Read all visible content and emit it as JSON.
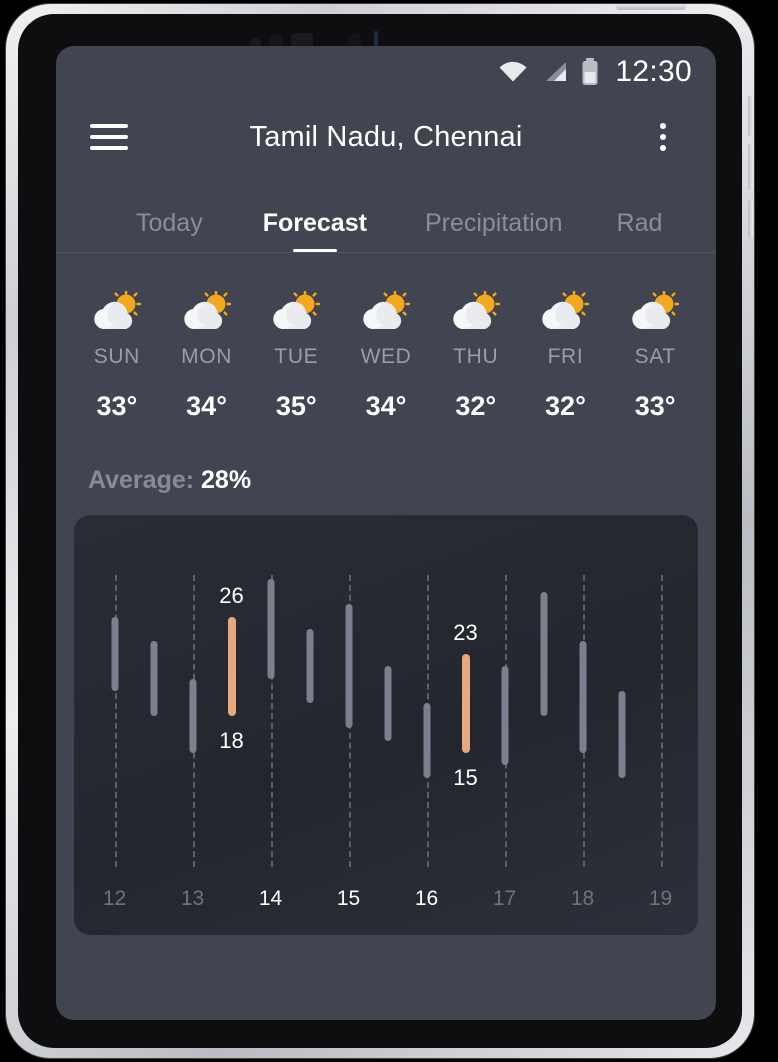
{
  "status_bar": {
    "time": "12:30",
    "icons": [
      "wifi-icon",
      "cellular-signal-icon",
      "battery-icon"
    ]
  },
  "app_bar": {
    "menu_icon": "hamburger-menu-icon",
    "title": "Tamil Nadu, Chennai",
    "overflow_icon": "more-vertical-icon"
  },
  "tabs": [
    {
      "label": "Today",
      "active": false
    },
    {
      "label": "Forecast",
      "active": true
    },
    {
      "label": "Precipitation",
      "active": false
    },
    {
      "label": "Rad",
      "active": false
    }
  ],
  "daily_forecast": [
    {
      "day": "SUN",
      "temp": "33°",
      "icon": "sun-behind-cloud-icon"
    },
    {
      "day": "MON",
      "temp": "34°",
      "icon": "sun-behind-cloud-icon"
    },
    {
      "day": "TUE",
      "temp": "35°",
      "icon": "sun-behind-cloud-icon"
    },
    {
      "day": "WED",
      "temp": "34°",
      "icon": "sun-behind-cloud-icon"
    },
    {
      "day": "THU",
      "temp": "32°",
      "icon": "sun-behind-cloud-icon"
    },
    {
      "day": "FRI",
      "temp": "32°",
      "icon": "sun-behind-cloud-icon"
    },
    {
      "day": "SAT",
      "temp": "33°",
      "icon": "sun-behind-cloud-icon"
    }
  ],
  "average": {
    "label": "Average:",
    "value": "28%"
  },
  "colors": {
    "screen_background": "#414451",
    "chart_background": "#272A33",
    "bar_default": "#7C808E",
    "bar_highlight": "#E7A87F",
    "text_primary": "#FFFFFF",
    "text_muted": "#8B8E99",
    "gridline": "#5C5F6B"
  },
  "chart_data": {
    "type": "bar",
    "title": "",
    "xlabel": "",
    "ylabel": "",
    "grid": "vertical-dashed",
    "legend": "none",
    "x_ticks": [
      {
        "label": "12",
        "highlighted": false
      },
      {
        "label": "13",
        "highlighted": false
      },
      {
        "label": "14",
        "highlighted": true
      },
      {
        "label": "15",
        "highlighted": true
      },
      {
        "label": "16",
        "highlighted": true
      },
      {
        "label": "17",
        "highlighted": false
      },
      {
        "label": "18",
        "highlighted": false
      },
      {
        "label": "19",
        "highlighted": false
      }
    ],
    "ylim": [
      10,
      30
    ],
    "bars": [
      {
        "index": 0,
        "low": 20,
        "high": 26,
        "highlighted": false,
        "label_top": "",
        "label_bottom": ""
      },
      {
        "index": 1,
        "low": 18,
        "high": 24,
        "highlighted": false,
        "label_top": "",
        "label_bottom": ""
      },
      {
        "index": 2,
        "low": 15,
        "high": 21,
        "highlighted": false,
        "label_top": "",
        "label_bottom": ""
      },
      {
        "index": 3,
        "low": 18,
        "high": 26,
        "highlighted": true,
        "label_top": "26",
        "label_bottom": "18"
      },
      {
        "index": 4,
        "low": 21,
        "high": 29,
        "highlighted": false,
        "label_top": "",
        "label_bottom": ""
      },
      {
        "index": 5,
        "low": 19,
        "high": 25,
        "highlighted": false,
        "label_top": "",
        "label_bottom": ""
      },
      {
        "index": 6,
        "low": 17,
        "high": 27,
        "highlighted": false,
        "label_top": "",
        "label_bottom": ""
      },
      {
        "index": 7,
        "low": 16,
        "high": 22,
        "highlighted": false,
        "label_top": "",
        "label_bottom": ""
      },
      {
        "index": 8,
        "low": 13,
        "high": 19,
        "highlighted": false,
        "label_top": "",
        "label_bottom": ""
      },
      {
        "index": 9,
        "low": 15,
        "high": 23,
        "highlighted": true,
        "label_top": "23",
        "label_bottom": "15"
      },
      {
        "index": 10,
        "low": 14,
        "high": 22,
        "highlighted": false,
        "label_top": "",
        "label_bottom": ""
      },
      {
        "index": 11,
        "low": 18,
        "high": 28,
        "highlighted": false,
        "label_top": "",
        "label_bottom": ""
      },
      {
        "index": 12,
        "low": 15,
        "high": 24,
        "highlighted": false,
        "label_top": "",
        "label_bottom": ""
      },
      {
        "index": 13,
        "low": 13,
        "high": 20,
        "highlighted": false,
        "label_top": "",
        "label_bottom": ""
      }
    ]
  }
}
